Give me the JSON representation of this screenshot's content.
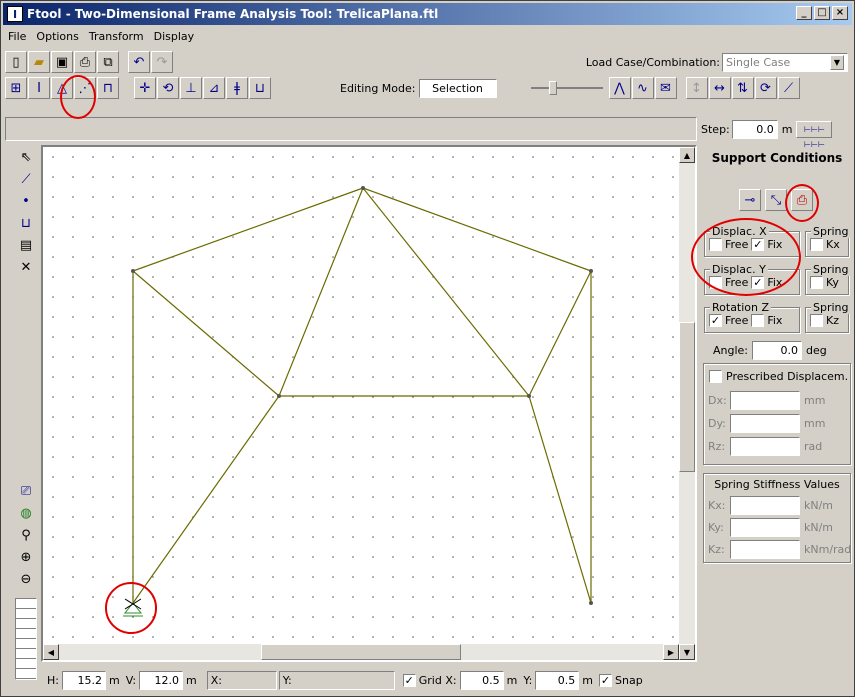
{
  "window": {
    "title": "Ftool - Two-Dimensional Frame Analysis Tool: TrelicaPlana.ftl",
    "min": "_",
    "max": "□",
    "close": "×"
  },
  "menu": [
    "File",
    "Options",
    "Transform",
    "Display"
  ],
  "toolbar": {
    "load_case_label": "Load Case/Combination:",
    "load_case_value": "Single Case",
    "editing_mode_label": "Editing Mode:",
    "editing_mode_value": "Selection",
    "step_label": "Step:",
    "step_value": "0.0",
    "step_unit": "m"
  },
  "panel": {
    "title": "Support Conditions",
    "displac_x": {
      "label": "Displac. X",
      "free": "Free",
      "fix": "Fix",
      "free_checked": false,
      "fix_checked": true
    },
    "displac_y": {
      "label": "Displac. Y",
      "free": "Free",
      "fix": "Fix",
      "free_checked": false,
      "fix_checked": true
    },
    "rotation_z": {
      "label": "Rotation Z",
      "free": "Free",
      "fix": "Fix",
      "free_checked": true,
      "fix_checked": false
    },
    "spring_label": "Spring",
    "spring_kx": "Kx",
    "spring_ky": "Ky",
    "spring_kz": "Kz",
    "angle_label": "Angle:",
    "angle_value": "0.0",
    "angle_unit": "deg",
    "prescribed_label": "Prescribed Displacem.",
    "dx_label": "Dx:",
    "dx_unit": "mm",
    "dy_label": "Dy:",
    "dy_unit": "mm",
    "rz_label": "Rz:",
    "rz_unit": "rad",
    "stiffness_title": "Spring Stiffness Values",
    "kx_label": "Kx:",
    "kx_unit": "kN/m",
    "ky_label": "Ky:",
    "ky_unit": "kN/m",
    "kz_label": "Kz:",
    "kz_unit": "kNm/rad"
  },
  "bottom": {
    "h_label": "H:",
    "h_value": "15.2",
    "h_unit": "m",
    "v_label": "V:",
    "v_value": "12.0",
    "v_unit": "m",
    "x_label": "X:",
    "y_label": "Y:",
    "grid_label": "Grid X:",
    "grid_x": "0.5",
    "grid_x_unit": "m",
    "grid_y_label": "Y:",
    "grid_y": "0.5",
    "grid_y_unit": "m",
    "snap_label": "Snap"
  },
  "colors": {
    "member": "#6b6b00",
    "highlight": "#e00000",
    "support": "#2e8b2e"
  }
}
